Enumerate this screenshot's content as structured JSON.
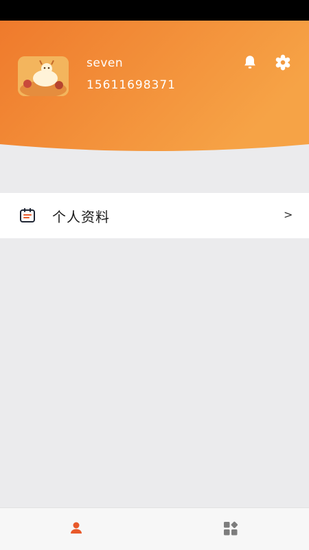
{
  "profile": {
    "username": "seven",
    "phone": "15611698371"
  },
  "header_icons": [
    "bell-icon",
    "gear-icon"
  ],
  "menu": {
    "items": [
      {
        "label": "个人资料",
        "icon": "calendar-icon",
        "chevron": ">"
      }
    ]
  },
  "bottom_nav": {
    "items": [
      {
        "icon": "person-icon",
        "active": true
      },
      {
        "icon": "apps-grid-icon",
        "active": false
      }
    ]
  },
  "colors": {
    "header_orange_start": "#ef7a2c",
    "header_orange_end": "#f6a346",
    "accent": "#e8592a",
    "inactive_icon": "#7d7d7d",
    "background": "#ebebed"
  }
}
